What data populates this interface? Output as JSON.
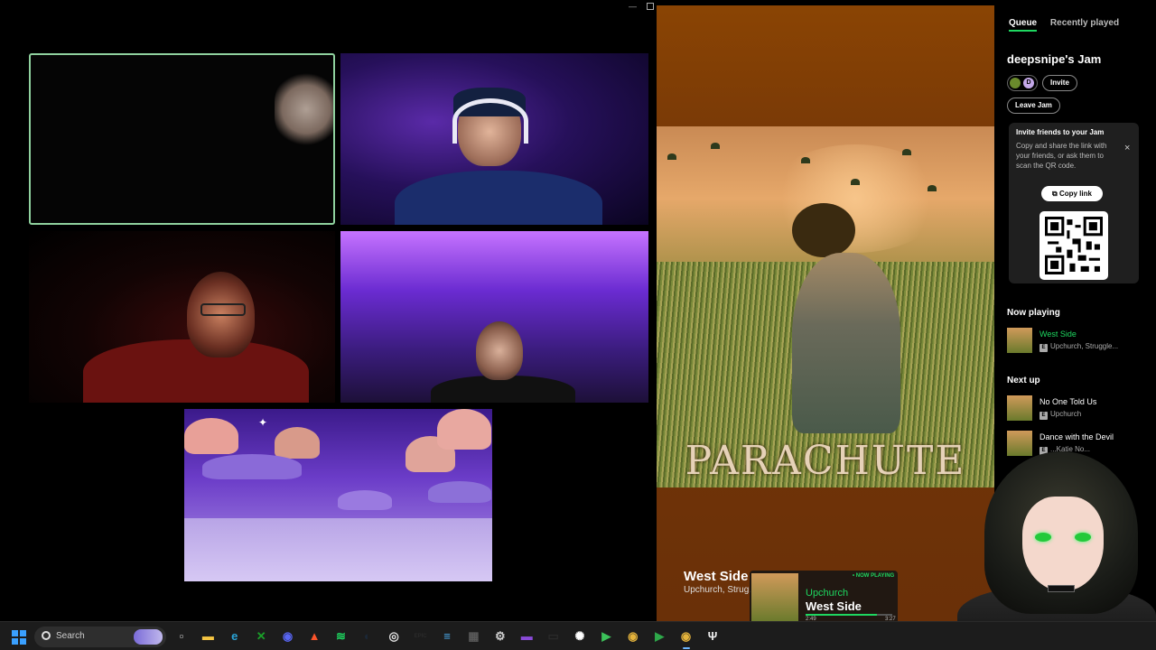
{
  "colors": {
    "spotify_green": "#1ed760",
    "accent_blue": "#3aa0ff"
  },
  "call": {
    "tiles": [
      {
        "name": "participant-1",
        "speaking": true
      },
      {
        "name": "participant-2"
      },
      {
        "name": "participant-3"
      },
      {
        "name": "participant-4"
      },
      {
        "name": "screen-share-game"
      }
    ]
  },
  "player": {
    "album_art_text": "PARACHUTE",
    "track_title": "West Side",
    "track_artist": "Upchurch, Strug..."
  },
  "widget": {
    "badge": "• NOW PLAYING",
    "artist": "Upchurch",
    "title": "West Side",
    "elapsed": "2:49",
    "duration": "3:27",
    "progress": 0.82
  },
  "queue_panel": {
    "tabs": [
      {
        "label": "Queue",
        "active": true
      },
      {
        "label": "Recently played",
        "active": false
      }
    ],
    "jam_title": "deepsnipe's Jam",
    "avatar_initial": "D",
    "invite_label": "Invite",
    "leave_label": "Leave Jam",
    "invite_card": {
      "title": "Invite friends to your Jam",
      "description": "Copy and share the link with your friends, or ask them to scan the QR code.",
      "close_icon": "×",
      "copy_label": "Copy link"
    },
    "now_playing_heading": "Now playing",
    "now_playing": {
      "title": "West Side",
      "subtitle": "Upchurch, Struggle...",
      "explicit": "E"
    },
    "next_up_heading": "Next up",
    "next_up": [
      {
        "title": "No One Told Us",
        "subtitle": "Upchurch",
        "explicit": "E"
      },
      {
        "title": "Dance with the Devil",
        "subtitle": "...Katie No...",
        "explicit": "E"
      }
    ]
  },
  "taskbar": {
    "search_placeholder": "Search",
    "icons": [
      {
        "name": "task-view-icon",
        "glyph": "▫",
        "color": "#d0d0d0"
      },
      {
        "name": "file-explorer-icon",
        "glyph": "▬",
        "color": "#f5c542"
      },
      {
        "name": "edge-icon",
        "glyph": "e",
        "color": "#2aa5d8"
      },
      {
        "name": "xbox-icon",
        "glyph": "✕",
        "color": "#1a9f29"
      },
      {
        "name": "discord-icon",
        "glyph": "◉",
        "color": "#5865f2"
      },
      {
        "name": "brave-icon",
        "glyph": "▲",
        "color": "#fb542b"
      },
      {
        "name": "spotify-icon",
        "glyph": "≋",
        "color": "#1ed760"
      },
      {
        "name": "steam-icon",
        "glyph": "◐",
        "color": "#1b2838"
      },
      {
        "name": "obs-icon",
        "glyph": "◎",
        "color": "#e0e0e0"
      },
      {
        "name": "epic-games-icon",
        "glyph": "EPIC",
        "color": "#2a2a2a"
      },
      {
        "name": "notepad-icon",
        "glyph": "≡",
        "color": "#4aa8e8"
      },
      {
        "name": "calculator-icon",
        "glyph": "▦",
        "color": "#5a5a5a"
      },
      {
        "name": "settings-icon",
        "glyph": "⚙",
        "color": "#d0d0d0"
      },
      {
        "name": "purple-app-icon",
        "glyph": "▬",
        "color": "#8a4ad8"
      },
      {
        "name": "terminal-icon",
        "glyph": "▭",
        "color": "#2a2a2a"
      },
      {
        "name": "steelseries-icon",
        "glyph": "✺",
        "color": "#ffffff"
      },
      {
        "name": "media-player-icon",
        "glyph": "▶",
        "color": "#3cc15a"
      },
      {
        "name": "chrome-icon",
        "glyph": "◉",
        "color": "#e4b33c"
      },
      {
        "name": "media-player-2-icon",
        "glyph": "▶",
        "color": "#2ea84a"
      },
      {
        "name": "chrome-active-icon",
        "glyph": "◉",
        "color": "#e4b33c"
      },
      {
        "name": "trident-icon",
        "glyph": "Ψ",
        "color": "#eeeeee"
      }
    ]
  }
}
